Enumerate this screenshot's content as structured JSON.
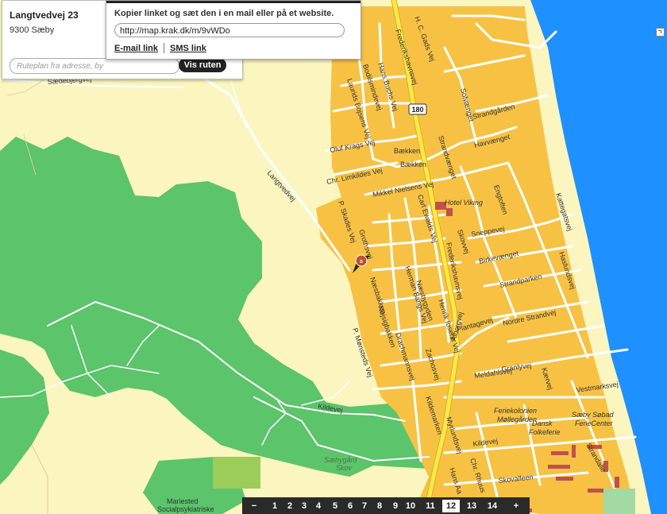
{
  "address": {
    "street": "Langtvedvej 23",
    "city": "9300 Sæby"
  },
  "route": {
    "placeholder": "Ruteplan fra adresse, by",
    "button": "Vis ruten"
  },
  "share": {
    "instruction": "Kopier linket og sæt den i en mail eller på et website.",
    "url": "http://map.krak.dk/m/9vWDo",
    "email_link": "E-mail link",
    "sms_link": "SMS link"
  },
  "map": {
    "road_number": "180",
    "streets": {
      "langtvedvej": "Langtvedvej",
      "saedebjergvej": "Sædebjergvej",
      "kildevej": "Kildevej",
      "frederikshavnsvej_n": "Frederikshavnsvej",
      "frederikshavnsvej_s": "Frederikshavnsvej",
      "hc_gads_vej": "H. C. Gads Vej",
      "hans_buchs_vej": "Hans Buchs Vej",
      "bodilsmindevej": "Bodilsmindevej",
      "laurids_bojsens_vej": "Laurids Bojsens Vej",
      "oluf_krags_vej": "Oluf Krags Vej",
      "chr_limkildes_vej": "Chr. Limkildes Vej",
      "baekken1": "Bækken",
      "baekken2": "Bækken",
      "mikkel_nielsens_vej": "Mikkel Nielsens Vej",
      "solvaenget": "Solvænget",
      "strandgaarden": "Strandgården",
      "havvaenget": "Havvænget",
      "strandvaenget": "Strandvænget",
      "engtoften": "Engtoften",
      "kattegatsvej": "Kattegatsvej",
      "carl_ewalds_vej": "Carl Ewalds Vej",
      "p_skades_vej": "P. Skades Vej",
      "grothsvej": "Grothsvej",
      "skovvej": "Skovvej",
      "sneppevej": "Sneppevej",
      "birkevaenget": "Birkevænget",
      "haslundsvej": "Haslundsvej",
      "strandparken": "Strandparken",
      "naesbakken": "Næsbakken",
      "naesbygade": "Næsbygade",
      "nojsigbakken": "Nøjsigbakken",
      "naesbygyden": "Næsbygyden",
      "herman_bangs_vej": "Herman Bangs Vej",
      "henrik_ibsens_vej": "Henrik Ibsens Vej",
      "plantagevej": "Plantagevej",
      "nordre_strandvej": "Nordre Strandvej",
      "p_monsteds_vej": "P. Mønsteds Vej",
      "drachmannsvej": "Drachmannsvej",
      "zachosvej": "Zachosvej",
      "alborgvej": "Ålborgvej",
      "meldahlsvej": "Meldahlsvej",
      "granlyvej": "Granlyvej",
      "kaervej": "Kærvej",
      "vestmarksvej": "Vestmarksvej",
      "kildemarken": "Kildemarken",
      "myrlundsvej": "Myrlundsvej",
      "kildevej2": "Kildevej",
      "chr_rhuus_vej": "Chr. Rhuus",
      "hans_aabels_vej": "Hans Aa",
      "skovalleen": "Skovalleen",
      "strandalle": "Strandalle"
    },
    "pois": {
      "hotel": "Hotel Viking",
      "ferie_line1": "Feriekolonien",
      "ferie_line2": "Møllegården",
      "dansk1": "Dansk",
      "dansk2": "Folkeferie",
      "saeby_sobad1": "Sæby Søbad",
      "saeby_sobad2": "FerieCenter",
      "wood1": "Sæbygård",
      "wood2": "Skov",
      "mariested1": "Mariested",
      "mariested2": "Socialpsykiatriske"
    },
    "marker_label": "s"
  },
  "zoom": {
    "minus": "−",
    "plus": "+",
    "levels": [
      "1",
      "2",
      "3",
      "4",
      "5",
      "6",
      "7",
      "8",
      "9",
      "10",
      "11",
      "12",
      "13",
      "14"
    ],
    "active": "12"
  },
  "colors": {
    "land": "#fbf5c0",
    "forest": "#5cc46a",
    "urban": "#f7c244",
    "sea": "#1e90ff",
    "road": "#ffffff",
    "main_road": "#ffe74a"
  }
}
